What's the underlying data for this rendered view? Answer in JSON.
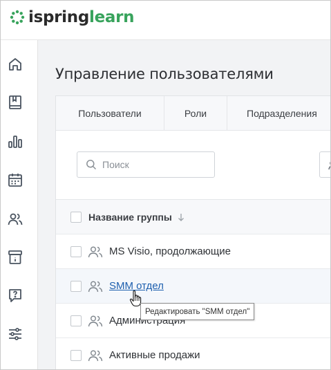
{
  "brand": {
    "name_part1": "ispring",
    "name_part2": "learn",
    "accent": "#38a35c"
  },
  "sidebar": {
    "items": [
      {
        "icon": "home-icon"
      },
      {
        "icon": "book-icon"
      },
      {
        "icon": "bar-chart-icon"
      },
      {
        "icon": "calendar-icon"
      },
      {
        "icon": "users-icon",
        "active": true
      },
      {
        "icon": "archive-info-icon"
      },
      {
        "icon": "question-chat-icon"
      },
      {
        "icon": "sliders-icon"
      }
    ]
  },
  "page": {
    "title": "Управление пользователями"
  },
  "tabs": [
    {
      "label": "Пользователи"
    },
    {
      "label": "Роли"
    },
    {
      "label": "Подразделения"
    }
  ],
  "search": {
    "placeholder": "Поиск"
  },
  "table": {
    "header": {
      "label": "Название группы",
      "sort": "descending"
    },
    "rows": [
      {
        "name": "MS Visio, продолжающие"
      },
      {
        "name": "SMM отдел",
        "link": true
      },
      {
        "name": "Администрация"
      },
      {
        "name": "Активные продажи"
      }
    ]
  },
  "tooltip": {
    "text": "Редактировать \"SMM отдел\""
  }
}
